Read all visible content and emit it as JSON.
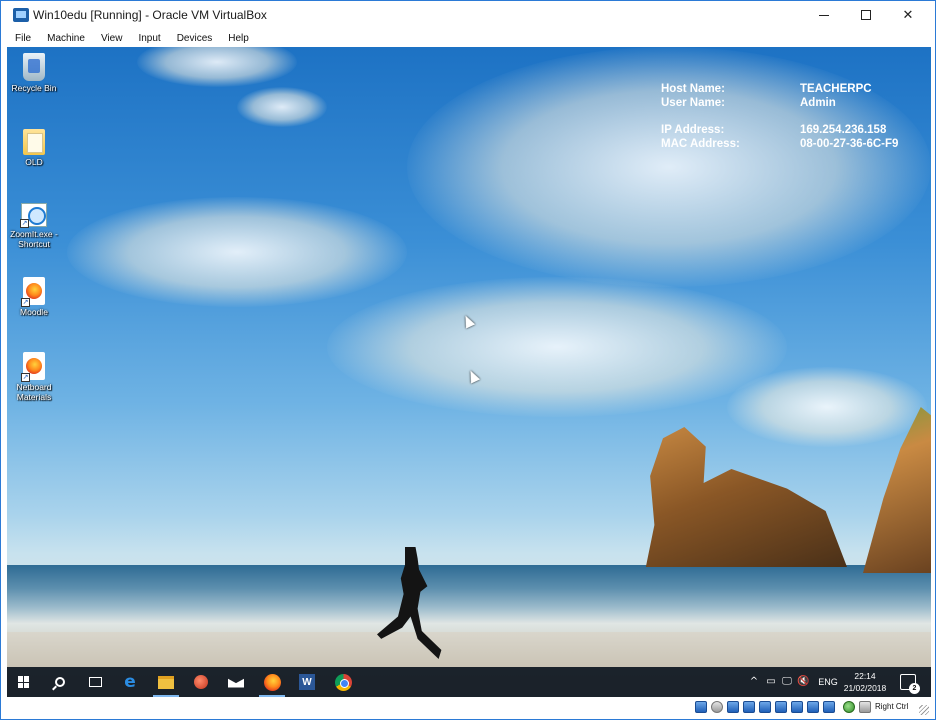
{
  "window": {
    "title": "Win10edu [Running] - Oracle VM VirtualBox",
    "controls": {
      "minimize": "minimize",
      "maximize": "maximize",
      "close": "✕"
    }
  },
  "menu": [
    "File",
    "Machine",
    "View",
    "Input",
    "Devices",
    "Help"
  ],
  "host_info": {
    "rows": [
      {
        "label": "Host Name:",
        "value": "TEACHERPC"
      },
      {
        "label": "User Name:",
        "value": "Admin"
      },
      {
        "label": "IP Address:",
        "value": "169.254.236.158"
      },
      {
        "label": "MAC Address:",
        "value": "08-00-27-36-6C-F9"
      }
    ]
  },
  "desktop_icons": [
    {
      "label": "Recycle Bin",
      "icon": "recycle-bin-icon"
    },
    {
      "label": "OLD",
      "icon": "folder-icon"
    },
    {
      "label": "ZoomIt.exe - Shortcut",
      "icon": "zoomit-icon"
    },
    {
      "label": "Moodle",
      "icon": "firefox-shortcut-icon"
    },
    {
      "label": "Netboard Materials",
      "icon": "firefox-shortcut-icon"
    }
  ],
  "taskbar": {
    "pinned": [
      "start",
      "search",
      "task-view",
      "edge",
      "file-explorer",
      "snail-app",
      "mail",
      "firefox",
      "word",
      "chrome"
    ],
    "tray": {
      "language": "ENG",
      "time": "22:14",
      "date": "21/02/2018",
      "notification_count": "2"
    }
  },
  "statusbar": {
    "host_key": "Right Ctrl"
  },
  "colors": {
    "taskbar": "#10182e",
    "title_bar": "#ffffff",
    "accent": "#1f5fb8"
  }
}
